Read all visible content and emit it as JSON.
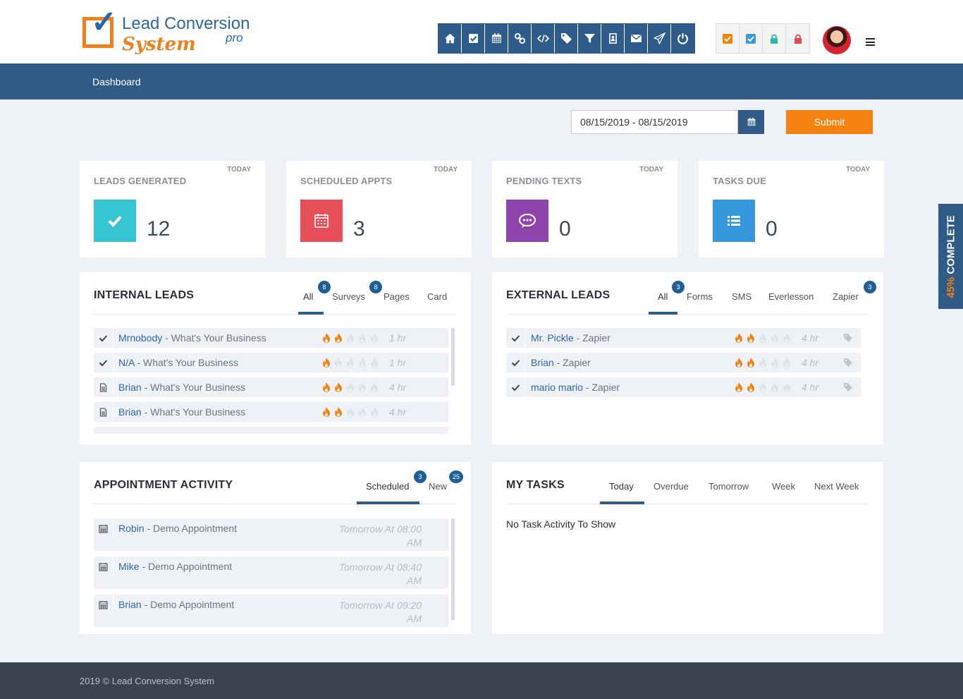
{
  "header": {
    "logo": {
      "line1": "Lead Conversion",
      "line2": "System",
      "suffix": "pro"
    },
    "toolbar": [
      "home-icon",
      "check-square-icon",
      "calendar-icon",
      "link-icon",
      "code-icon",
      "tags-icon",
      "filter-icon",
      "contacts-icon",
      "envelope-icon",
      "send-icon",
      "power-icon"
    ],
    "status_icons": [
      {
        "name": "orange-check-icon",
        "color": "#f5820f"
      },
      {
        "name": "blue-check-icon",
        "color": "#3a9ad9"
      },
      {
        "name": "teal-lock-icon",
        "color": "#2ab7a9"
      },
      {
        "name": "red-lock-icon",
        "color": "#e5474f"
      }
    ]
  },
  "nav": {
    "dashboard_label": "Dashboard"
  },
  "filter": {
    "date_range": "08/15/2019 - 08/15/2019",
    "submit_label": "Submit"
  },
  "stats": [
    {
      "title": "LEADS GENERATED",
      "period": "TODAY",
      "value": "12",
      "icon": "check-icon",
      "color": "#36c6d3"
    },
    {
      "title": "SCHEDULED APPTS",
      "period": "TODAY",
      "value": "3",
      "icon": "calendar-icon",
      "color": "#e7505a"
    },
    {
      "title": "PENDING TEXTS",
      "period": "TODAY",
      "value": "0",
      "icon": "chat-icon",
      "color": "#8e44ad"
    },
    {
      "title": "TASKS DUE",
      "period": "TODAY",
      "value": "0",
      "icon": "list-icon",
      "color": "#3598dc"
    }
  ],
  "internal_leads": {
    "title": "INTERNAL LEADS",
    "tabs": [
      {
        "label": "All",
        "badge": "8"
      },
      {
        "label": "Surveys",
        "badge": "8"
      },
      {
        "label": "Pages"
      },
      {
        "label": "Card"
      }
    ],
    "rows": [
      {
        "icon": "check-icon",
        "name": "Mrnobody",
        "source": " - What's Your Business",
        "flames": 2,
        "time": "1 hr"
      },
      {
        "icon": "check-icon",
        "name": "N/A",
        "source": " - What's Your Business",
        "flames": 1,
        "time": "1 hr"
      },
      {
        "icon": "document-icon",
        "name": "Brian",
        "source": " - What's Your Business",
        "flames": 2,
        "time": "4 hr"
      },
      {
        "icon": "document-icon",
        "name": "Brian",
        "source": " - What's Your Business",
        "flames": 2,
        "time": "4 hr"
      }
    ]
  },
  "external_leads": {
    "title": "EXTERNAL LEADS",
    "tabs": [
      {
        "label": "All",
        "badge": "3"
      },
      {
        "label": "Forms"
      },
      {
        "label": "SMS"
      },
      {
        "label": "Everlesson"
      },
      {
        "label": "Zapier",
        "badge": "3"
      }
    ],
    "rows": [
      {
        "name": "Mr. Pickle",
        "source": " - Zapier",
        "flames": 2,
        "time": "4 hr"
      },
      {
        "name": "Brian",
        "source": " - Zapier",
        "flames": 2,
        "time": "4 hr"
      },
      {
        "name": "mario mario",
        "source": " - Zapier",
        "flames": 2,
        "time": "4 hr"
      }
    ]
  },
  "appointments": {
    "title": "APPOINTMENT ACTIVITY",
    "tabs": [
      {
        "label": "Scheduled",
        "badge": "3"
      },
      {
        "label": "New",
        "badge": "25"
      }
    ],
    "rows": [
      {
        "name": "Robin",
        "desc": " - Demo Appointment",
        "time": "Tomorrow At 08:00 AM"
      },
      {
        "name": "Mike",
        "desc": " - Demo Appointment",
        "time": "Tomorrow At 08:40 AM"
      },
      {
        "name": "Brian",
        "desc": " - Demo Appointment",
        "time": "Tomorrow At 09:20 AM"
      }
    ]
  },
  "tasks": {
    "title": "MY TASKS",
    "tabs": [
      "Today",
      "Overdue",
      "Tomorrow",
      "Week",
      "Next Week"
    ],
    "empty_text": "No Task Activity To Show"
  },
  "progress": {
    "percent": "45%",
    "label": " COMPLETE",
    "value": 0.45
  },
  "footer": {
    "text": "2019 © Lead Conversion System"
  }
}
